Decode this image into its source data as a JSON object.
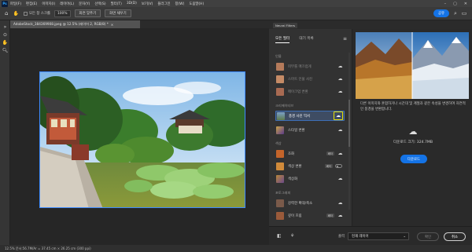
{
  "menubar": {
    "logo": "Ps",
    "items": [
      "파일(F)",
      "편집(E)",
      "이미지(I)",
      "레이어(L)",
      "문자(Y)",
      "선택(S)",
      "필터(T)",
      "3D(D)",
      "보기(V)",
      "플러그인",
      "창(W)",
      "도움말(H)"
    ]
  },
  "options": {
    "checkbox_label": "모든 창 스크롤",
    "zoom": "100%",
    "fit_screen": "화면 맞추기",
    "fill_screen": "화면 채우기",
    "share": "공유"
  },
  "document": {
    "tab_title": "AdobeStock_384369908.jpeg @ 12.5% (레이어 2, RGB/8) *",
    "close": "×"
  },
  "status": {
    "text": "12.5%   문서:56.7M/Ar = 37.45 cm × 26.25 cm (300 ppi)"
  },
  "neural_filters": {
    "panel_title": "Neural Filters",
    "tabs": [
      "모든 필터",
      "대기 목록"
    ],
    "categories": {
      "portrait": "인물",
      "creative": "크리에이티브",
      "color": "색상",
      "photography": "포토그래피"
    },
    "filters": [
      {
        "label": "피부를 매끄럽게",
        "dim": true
      },
      {
        "label": "스마트 인물 사진",
        "dim": true
      },
      {
        "label": "메이크업 변환",
        "dim": true
      },
      {
        "label": "풍경 사진 믹서",
        "dim": false,
        "selected": true
      },
      {
        "label": "스타일 변환",
        "dim": false
      },
      {
        "label": "조화",
        "dim": false,
        "badge": "베타"
      },
      {
        "label": "색상 변환",
        "dim": false,
        "badge": "베타"
      },
      {
        "label": "색상화",
        "dim": false
      },
      {
        "label": "강력한 확대/축소",
        "dim": false
      },
      {
        "label": "깊이 흐림",
        "dim": false,
        "badge": "베타"
      }
    ],
    "beta_label": "베타"
  },
  "preview": {
    "description": "다른 이미지와 혼합하거나 시간대 및 계절과 같은 속성을 변경하여 자연적인 풍경을 변환합니다.",
    "download_size": "다운로드 크기: 324.7MB",
    "download_button": "다운로드"
  },
  "bottom": {
    "output_label": "출력",
    "output_value": "현재 레이어",
    "ok": "확인",
    "cancel": "취소"
  },
  "colors": {
    "accent": "#1473e6",
    "highlight": "#e8e000",
    "selection": "#3d8bff"
  }
}
